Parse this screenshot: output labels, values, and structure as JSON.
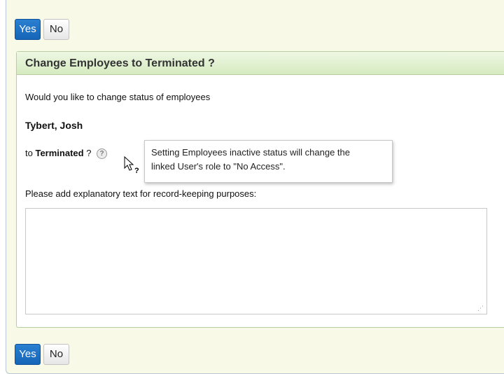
{
  "top_buttons": {
    "yes": "Yes",
    "no": "No"
  },
  "panel": {
    "title": "Change Employees to Terminated ?",
    "intro": "Would you like to change status of employees",
    "employee_name": "Tybert, Josh",
    "to_prefix": "to",
    "status": "Terminated",
    "question_mark": "?",
    "explanation_label": "Please add explanatory text for record-keeping purposes:",
    "explanation_value": ""
  },
  "tooltip": {
    "line1": "Setting Employees inactive status will change the",
    "line2": "linked User's role to \"No Access\"."
  },
  "bottom_buttons": {
    "yes": "Yes",
    "no": "No"
  },
  "colors": {
    "yes_button": "#1a6dc2",
    "panel_header": "#d6ebc0",
    "background": "#f9f9e8"
  },
  "icons": [
    "help-icon",
    "mouse-pointer-icon"
  ]
}
